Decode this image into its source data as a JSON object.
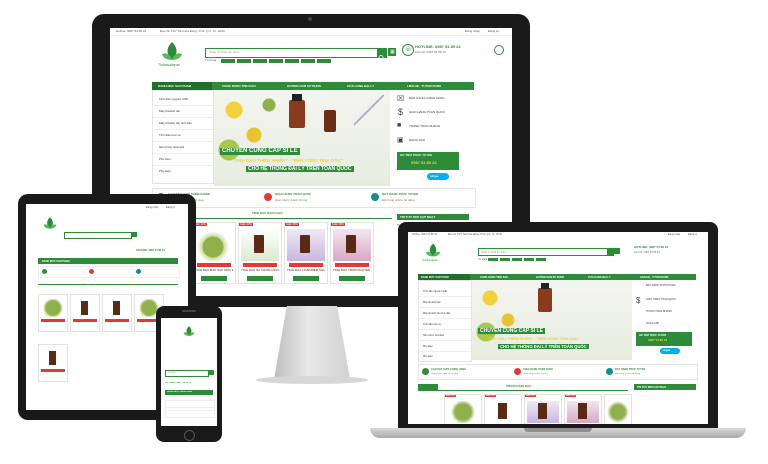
{
  "brand": {
    "logo_text": "Tinhdaudepan",
    "green": "#2e8b3a",
    "dark_green": "#1f6f2a",
    "red": "#e53935",
    "teal": "#0e8e8e"
  },
  "topbar": {
    "contact": "Hotline: 0987 54 89 24",
    "address": "Địa chỉ: 72/7 Tân Hòa Đông, P.14, Q.6, Tp. HCM",
    "login": "Đăng nhập",
    "register": "Đăng ký"
  },
  "header": {
    "search_placeholder": "Nhập từ khóa tìm kiếm...",
    "hotline_label": "HOTLINE: 0987 54 89 24",
    "hotline_sub": "Liên hệ: 0987 54 89 24",
    "tags_label": "Từ khóa"
  },
  "menu": {
    "category_title": "DANH MỤC SẢN PHẨM",
    "items": [
      "CÔNG DỤNG TINH DẦU",
      "HƯỚNG DẪN SỬ DỤNG",
      "CỬA HÀNG ĐẠI LÝ",
      "LIÊN HỆ - TUYỂN DỤNG"
    ]
  },
  "sidebar": {
    "items": [
      "Tinh dầu nguyên chất",
      "Máy khuếch tán",
      "Máy khuếch tán tinh dầu",
      "Tinh dầu treo xe",
      "Nến thơm Scented",
      "Phụ kiện",
      "Phụ kiện"
    ]
  },
  "banner": {
    "line1": "CHUYÊN CUNG CẤP SỈ LẺ",
    "line2": "\"TINH DẦU THIÊN NHIÊN\" - \"ĐÈN XÔNG TINH DẦU\"",
    "line3": "CHO HỆ THỐNG ĐẠI LÝ TRÊN TOÀN QUỐC"
  },
  "side_info": {
    "items": [
      "BẢO HÀNH CHÍNH HÃNG",
      "GIAO HÀNG TOÀN QUỐC",
      "THANH TOÁN NHANH",
      "NGỌC ANH"
    ],
    "hotline_title": "HỖ TRỢ TRỰC TUYẾN",
    "hotline": "0987 54 89 24",
    "skype": "skype"
  },
  "features": [
    {
      "title": "CAM KẾT 100% CHÍNH HÃNG",
      "desc": "Nguồn gốc xuất xứ rõ ràng"
    },
    {
      "title": "GIAO HÀNG TOÀN QUỐC",
      "desc": "Giao hàng nhanh chóng"
    },
    {
      "title": "ĐẶT HÀNG TRỰC TUYẾN",
      "desc": "Đặt hàng online dễ dàng"
    }
  ],
  "section": {
    "title": "TINH DẦU BÁN CHẠY",
    "news": "TIN TỨC MỚI CẬP NHẬT",
    "news_text": "Tinh dầu hồng"
  },
  "products": [
    {
      "name": "TINH DẦU ĐẶC SẢN MỘC ĐẶC",
      "price": "75.000 đ",
      "badge": "Giảm 10%",
      "button": "MUA NGAY"
    },
    {
      "name": "TINH DẦU SẢ CHANH NGUYÊN CHẤT",
      "price": "75.000 đ",
      "badge": "Giảm 20%",
      "button": "MUA NGAY"
    },
    {
      "name": "TINH DẦU LAVENDER NGUYÊN CHẤT",
      "price": "75.000 đ",
      "badge": "Giảm 30%",
      "button": "MUA NGAY"
    },
    {
      "name": "TINH DẦU TRÀM NGUYÊN CHẤT",
      "price": "75.000 đ",
      "badge": "Giảm 30%",
      "button": "MUA NGAY"
    }
  ],
  "phone": {
    "search_placeholder": "Tìm kiếm...",
    "hotline": "HOTLINE: 0987 54 89 24",
    "menu": "DANH MỤC SẢN PHẨM"
  },
  "tablet": {
    "hotline": "HOTLINE: 0987 54 89 24",
    "menu": "DANH MỤC SẢN PHẨM"
  }
}
